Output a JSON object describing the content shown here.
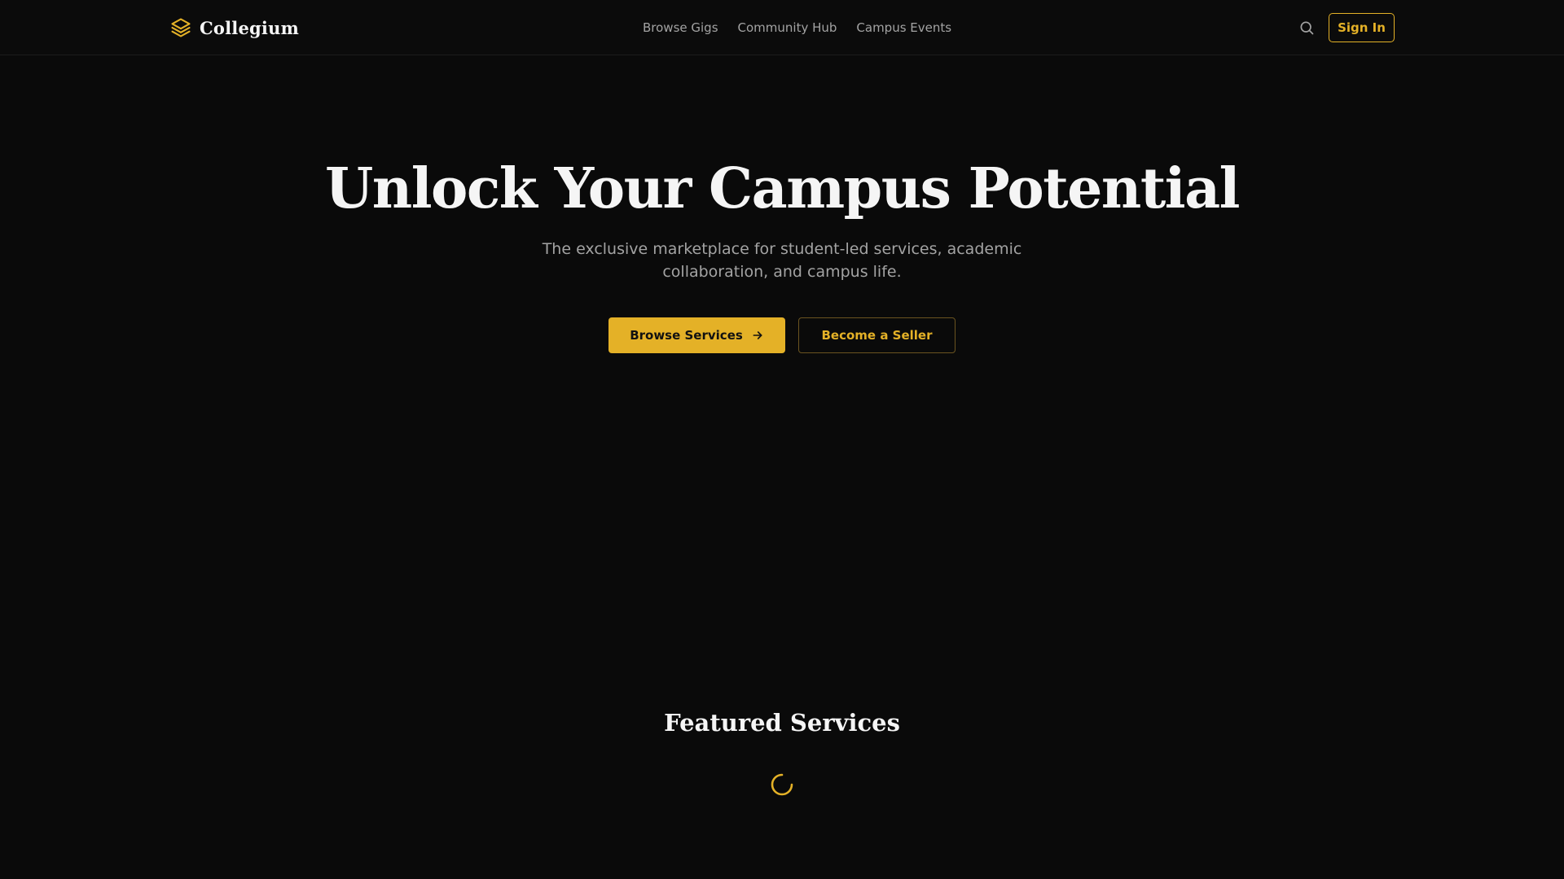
{
  "header": {
    "brand_name": "Collegium",
    "brand_icon": "layers-icon",
    "nav_links": [
      {
        "label": "Browse Gigs"
      },
      {
        "label": "Community Hub"
      },
      {
        "label": "Campus Events"
      }
    ],
    "search_icon": "search-icon",
    "sign_in_label": "Sign In"
  },
  "hero": {
    "title": "Unlock Your Campus Potential",
    "subtitle": "The exclusive marketplace for student-led services, academic collaboration, and campus life.",
    "primary_button": "Browse Services",
    "primary_button_icon": "arrow-right-icon",
    "secondary_button": "Become a Seller"
  },
  "featured": {
    "title": "Featured Services",
    "loading_icon": "loading-spinner-icon"
  },
  "colors": {
    "background": "#0a0a0a",
    "accent": "#e4b127",
    "text_primary": "#f5f5f5",
    "text_muted": "#a3a3a3"
  }
}
